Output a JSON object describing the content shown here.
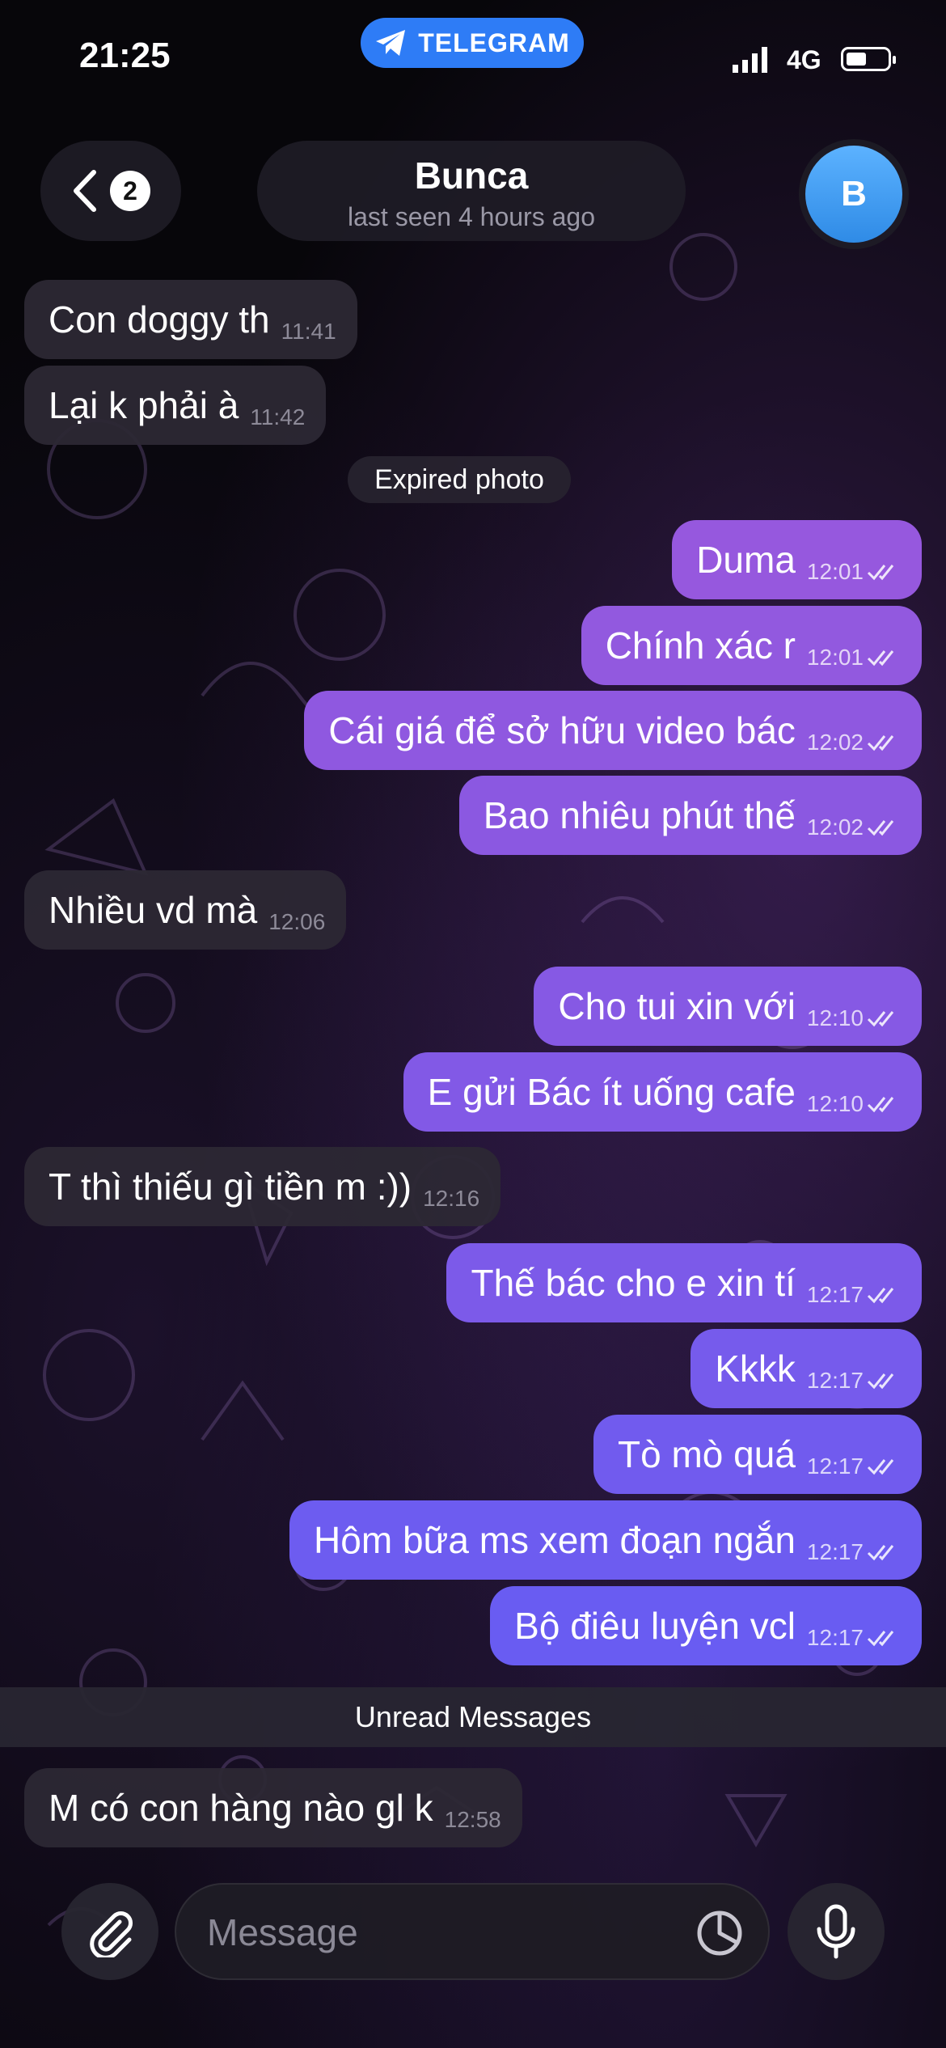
{
  "status_bar": {
    "time": "21:25",
    "banner": "TELEGRAM",
    "network": "4G"
  },
  "header": {
    "back_badge": "2",
    "title": "Bunca",
    "subtitle": "last seen 4 hours ago",
    "avatar_letter": "B"
  },
  "messages": [
    {
      "text": "Con doggy th",
      "time": "11:41"
    },
    {
      "text": "Lại k phải à",
      "time": "11:42"
    },
    {
      "text": "Duma",
      "time": "12:01"
    },
    {
      "text": "Chính xác r",
      "time": "12:01"
    },
    {
      "text": "Cái giá để sở hữu video bác",
      "time": "12:02"
    },
    {
      "text": "Bao nhiêu phút thế",
      "time": "12:02"
    },
    {
      "text": "Nhiều vd mà",
      "time": "12:06"
    },
    {
      "text": "Cho tui xin với",
      "time": "12:10"
    },
    {
      "text": "E gửi Bác ít uống cafe",
      "time": "12:10"
    },
    {
      "text": "T thì thiếu gì tiền m :))",
      "time": "12:16"
    },
    {
      "text": "Thế bác cho e xin tí",
      "time": "12:17"
    },
    {
      "text": "Kkkk",
      "time": "12:17"
    },
    {
      "text": "Tò mò quá",
      "time": "12:17"
    },
    {
      "text": "Hôm bữa ms xem đoạn ngắn",
      "time": "12:17"
    },
    {
      "text": "Bộ điêu luyện vcl",
      "time": "12:17"
    },
    {
      "text": "M có con hàng nào gl k",
      "time": "12:58"
    }
  ],
  "service_message": "Expired photo",
  "unread_divider": "Unread Messages",
  "composer": {
    "placeholder": "Message"
  },
  "icons": [
    "telegram-icon",
    "signal-icon",
    "battery-icon",
    "back-chevron-icon",
    "double-check-icon",
    "paperclip-icon",
    "sticker-icon",
    "microphone-icon"
  ],
  "colors": {
    "outgoing_top": "#9a5ce0",
    "outgoing_bottom": "#6a5cf2",
    "incoming": "#2c2834",
    "accent": "#2e7cf6"
  }
}
